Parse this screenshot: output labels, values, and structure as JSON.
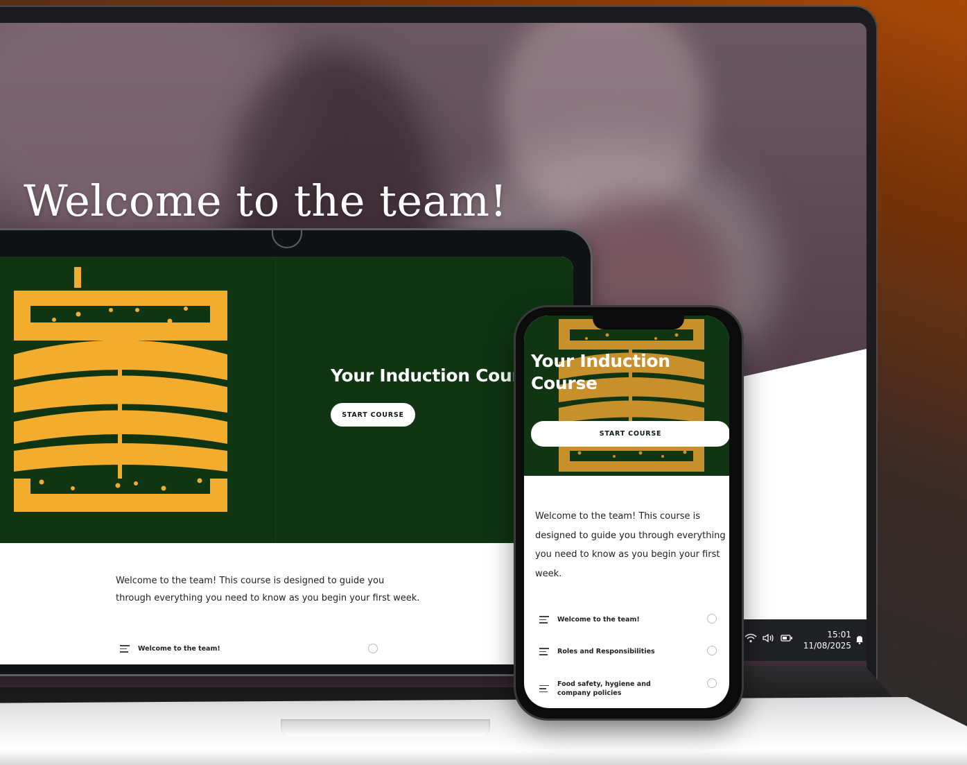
{
  "hero": {
    "title": "Welcome to the team!"
  },
  "course": {
    "title": "Your Induction Course",
    "phone_title": "Your Induction Course",
    "start_label": "START COURSE",
    "description": "Welcome to the team! This course is designed to guide you through everything you need to know as you begin your first week."
  },
  "lessons": [
    {
      "label": "Welcome to the team!"
    },
    {
      "label": "Roles and Responsibilities"
    },
    {
      "label": "Food safety, hygiene and company policies"
    }
  ],
  "taskbar": {
    "wifi_icon": "wifi-icon",
    "volume_icon": "volume-icon",
    "battery_icon": "battery-icon",
    "time": "15:01",
    "date": "11/08/2025"
  },
  "colors": {
    "hero_green": "#0f3512",
    "logo_gold": "#f2ad2f",
    "button_white": "#ffffff"
  }
}
